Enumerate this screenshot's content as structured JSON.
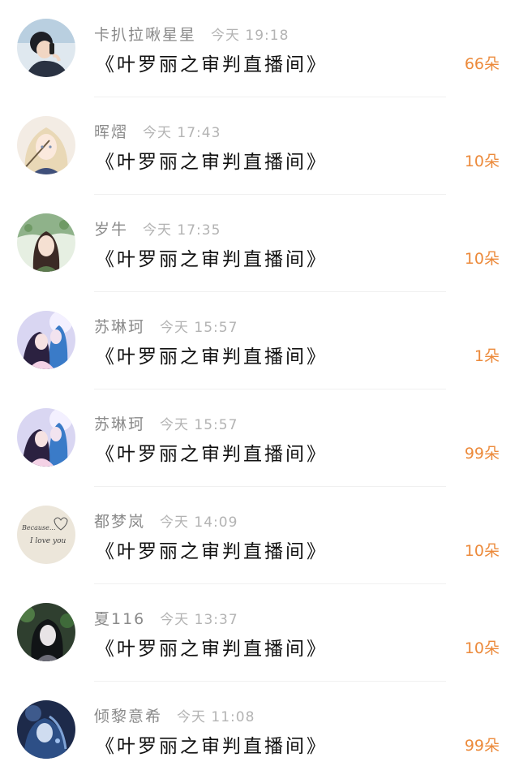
{
  "records": [
    {
      "name": "卡扒拉啾星星",
      "day": "今天",
      "time": "19:18",
      "gift": "《叶罗丽之审判直播间》",
      "count": "66朵",
      "avatar": "boy-phone-avatar"
    },
    {
      "name": "晖熠",
      "day": "今天",
      "time": "17:43",
      "gift": "《叶罗丽之审判直播间》",
      "count": "10朵",
      "avatar": "blonde-girl-avatar"
    },
    {
      "name": "岁牛",
      "day": "今天",
      "time": "17:35",
      "gift": "《叶罗丽之审判直播间》",
      "count": "10朵",
      "avatar": "green-girl-avatar"
    },
    {
      "name": "苏琳珂",
      "day": "今天",
      "time": "15:57",
      "gift": "《叶罗丽之审判直播间》",
      "count": "1朵",
      "avatar": "couple-avatar"
    },
    {
      "name": "苏琳珂",
      "day": "今天",
      "time": "15:57",
      "gift": "《叶罗丽之审判直播间》",
      "count": "99朵",
      "avatar": "couple-avatar"
    },
    {
      "name": "都梦岚",
      "day": "今天",
      "time": "14:09",
      "gift": "《叶罗丽之审判直播间》",
      "count": "10朵",
      "avatar": "love-note-avatar"
    },
    {
      "name": "夏116",
      "day": "今天",
      "time": "13:37",
      "gift": "《叶罗丽之审判直播间》",
      "count": "10朵",
      "avatar": "dark-hair-girl-avatar"
    },
    {
      "name": "倾黎意希",
      "day": "今天",
      "time": "11:08",
      "gift": "《叶罗丽之审判直播间》",
      "count": "99朵",
      "avatar": "blue-fantasy-avatar"
    }
  ],
  "colors": {
    "name": "#8a8a8a",
    "time": "#b3b3b3",
    "gift": "#111111",
    "count": "#ec8a3b"
  },
  "avatar_text": {
    "love_note_line1": "Because...",
    "love_note_line2": "I love you"
  }
}
